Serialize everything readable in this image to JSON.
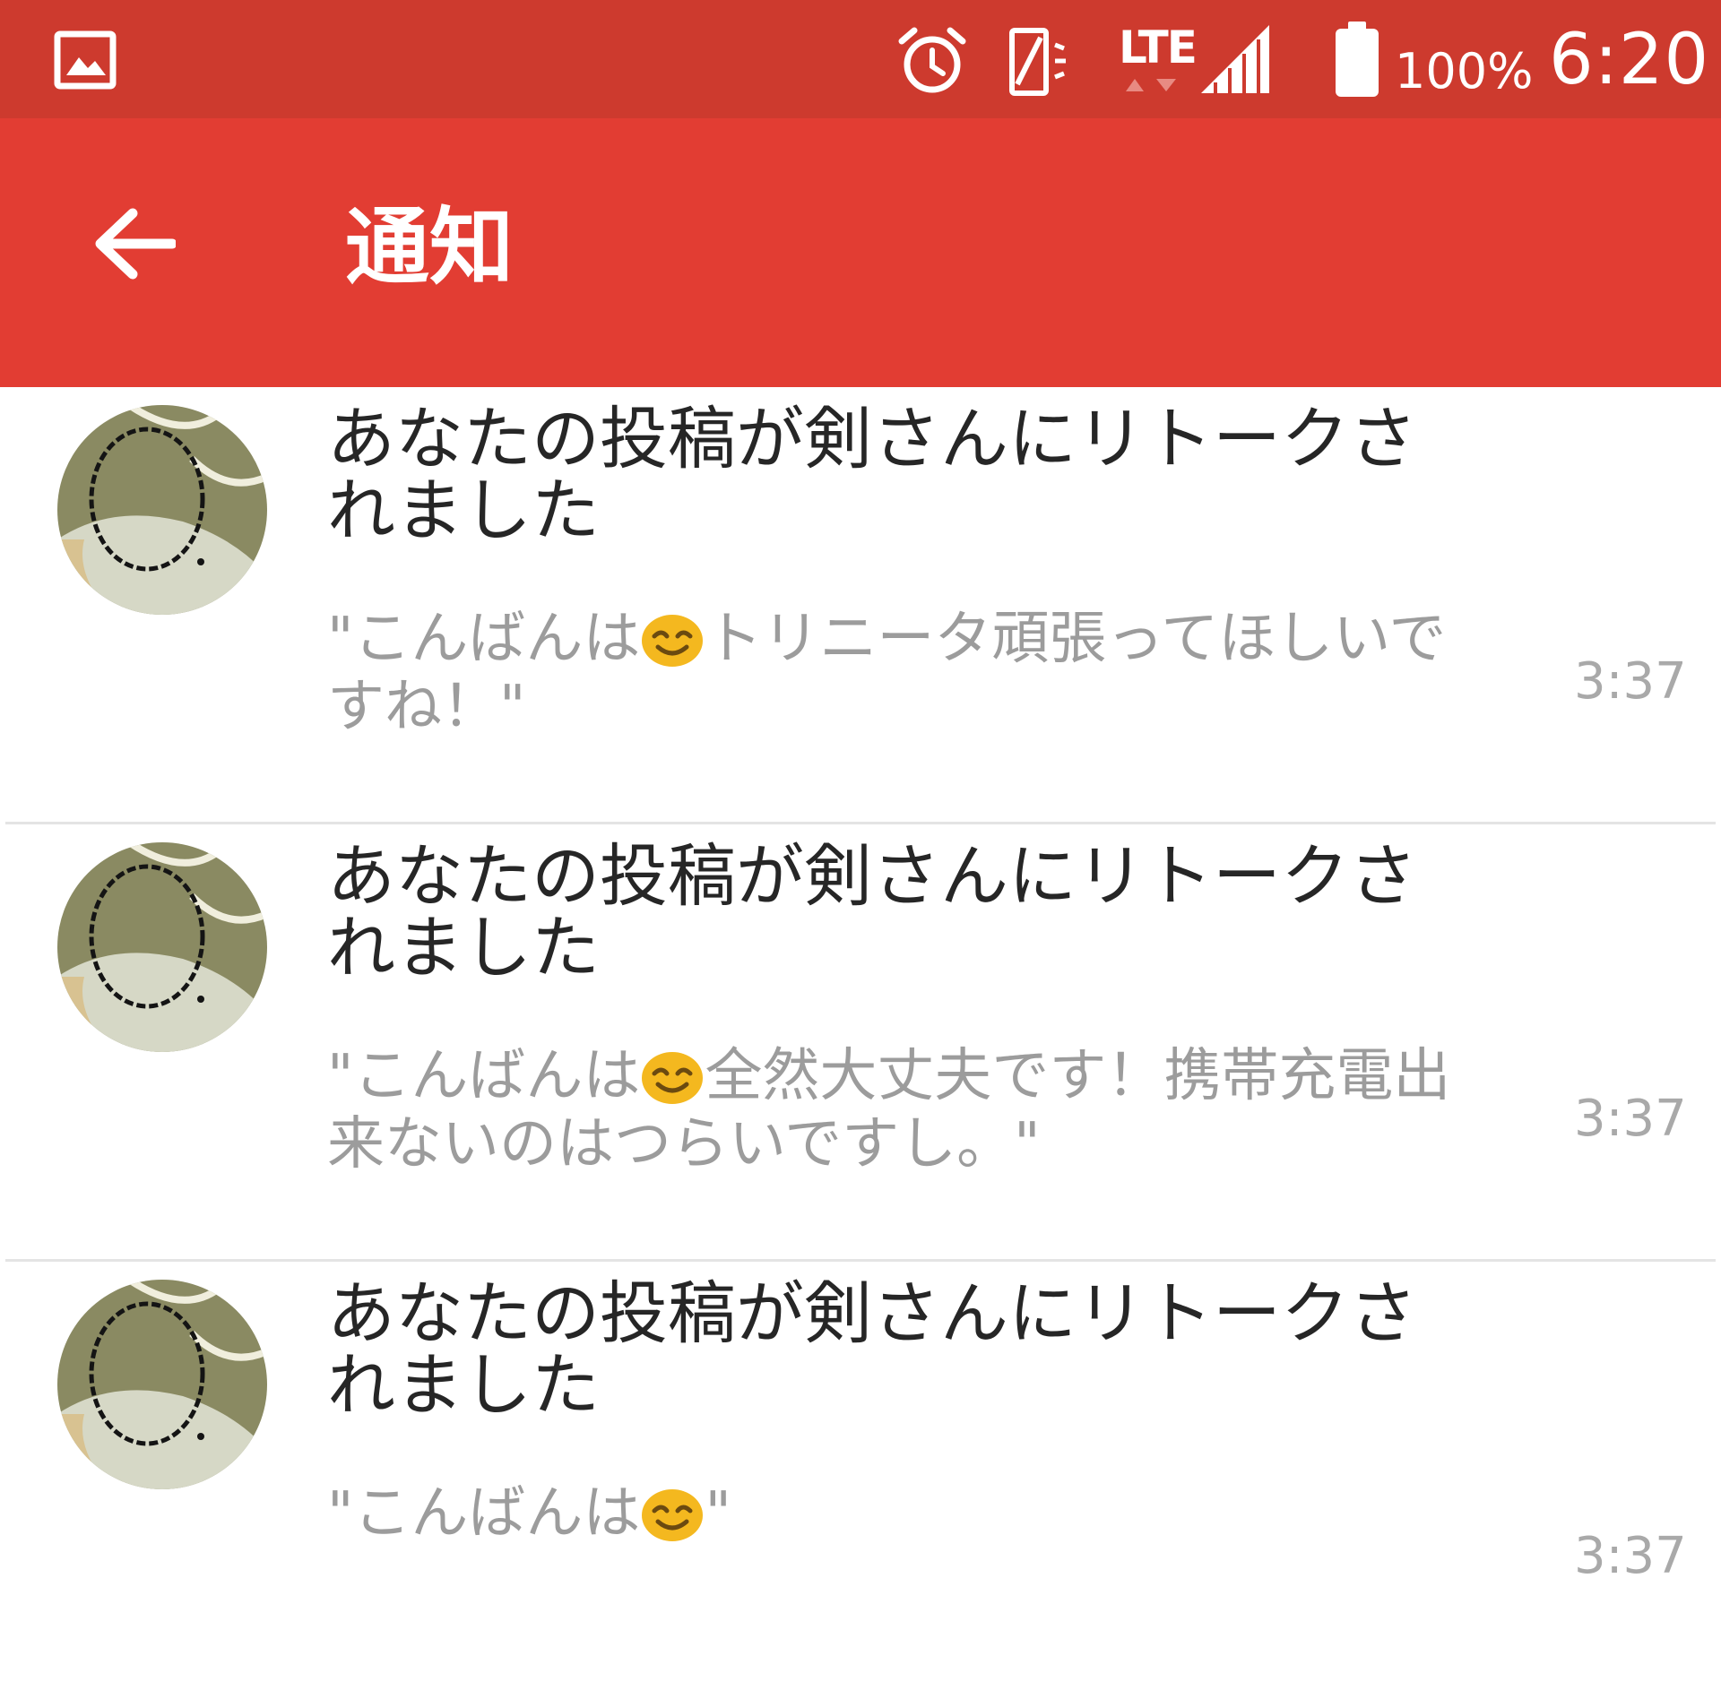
{
  "status_bar": {
    "network_type": "LTE",
    "battery_percent": "100%",
    "time": "6:20",
    "colors": {
      "background": "#cd3a2e"
    },
    "icons": [
      "gallery-icon",
      "alarm-icon",
      "vibrate-icon",
      "data-arrows-icon",
      "signal-icon",
      "battery-icon"
    ]
  },
  "header": {
    "title": "通知",
    "back_icon": "arrow-left-icon",
    "colors": {
      "background": "#e23d33",
      "text": "#ffffff"
    }
  },
  "notifications": [
    {
      "title": "あなたの投稿が剣さんにリトークされました",
      "snippet_prefix": "\"こんばんは",
      "emoji": "smiling-face-icon",
      "snippet_suffix": "トリニータ頑張ってほしいですね！\"",
      "time": "3:37"
    },
    {
      "title": "あなたの投稿が剣さんにリトークされました",
      "snippet_prefix": "\"こんばんは",
      "emoji": "smiling-face-icon",
      "snippet_suffix": "全然大丈夫です！携帯充電出来ないのはつらいですし。\"",
      "time": "3:37"
    },
    {
      "title": "あなたの投稿が剣さんにリトークされました",
      "snippet_prefix": "\"こんばんは",
      "emoji": "smiling-face-icon",
      "snippet_suffix": "\"",
      "time": "3:37"
    }
  ]
}
